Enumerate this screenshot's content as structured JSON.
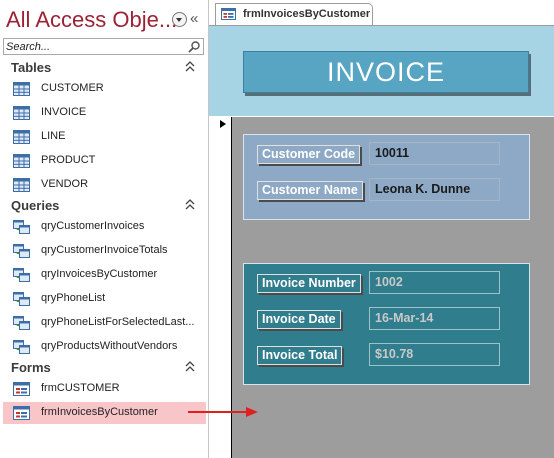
{
  "nav_pane": {
    "title": "All Access Obje...",
    "collapse_glyph": "«",
    "search_placeholder": "Search...",
    "groups": [
      {
        "label": "Tables",
        "items": [
          {
            "label": "CUSTOMER",
            "icon": "table-icon"
          },
          {
            "label": "INVOICE",
            "icon": "table-icon"
          },
          {
            "label": "LINE",
            "icon": "table-icon"
          },
          {
            "label": "PRODUCT",
            "icon": "table-icon"
          },
          {
            "label": "VENDOR",
            "icon": "table-icon"
          }
        ]
      },
      {
        "label": "Queries",
        "items": [
          {
            "label": "qryCustomerInvoices",
            "icon": "query-icon"
          },
          {
            "label": "qryCustomerInvoiceTotals",
            "icon": "query-icon"
          },
          {
            "label": "qryInvoicesByCustomer",
            "icon": "query-icon"
          },
          {
            "label": "qryPhoneList",
            "icon": "query-icon"
          },
          {
            "label": "qryPhoneListForSelectedLast...",
            "icon": "query-icon"
          },
          {
            "label": "qryProductsWithoutVendors",
            "icon": "query-icon"
          }
        ]
      },
      {
        "label": "Forms",
        "items": [
          {
            "label": "frmCUSTOMER",
            "icon": "form-icon"
          },
          {
            "label": "frmInvoicesByCustomer",
            "icon": "form-icon",
            "selected": true
          }
        ]
      }
    ]
  },
  "document_tab": {
    "label": "frmInvoicesByCustomer",
    "icon": "form-icon"
  },
  "form": {
    "title": "INVOICE",
    "customer_code_label": "Customer Code",
    "customer_code": "10011",
    "customer_name_label": "Customer Name",
    "customer_name": "Leona K. Dunne",
    "invoice_number_label": "Invoice Number",
    "invoice_number": "1002",
    "invoice_date_label": "Invoice Date",
    "invoice_date": "16-Mar-14",
    "invoice_total_label": "Invoice Total",
    "invoice_total": "$10.78"
  },
  "colors": {
    "nav_title": "#9b2335",
    "selected_item_bg": "#f8c6c8",
    "form_header_bg": "#a7d4e4",
    "title_box_bg": "#58a5c3",
    "detail_bg": "#9d9d9d",
    "customer_panel_bg": "#8da9c6",
    "invoice_panel_bg": "#2f7d8d",
    "annotation_arrow": "#e02020"
  }
}
